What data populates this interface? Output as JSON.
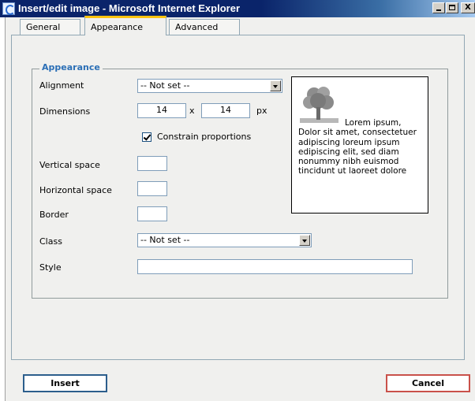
{
  "window": {
    "title": "Insert/edit image - Microsoft Internet Explorer",
    "controls": {
      "minimize": "_",
      "maximize": "□",
      "close": "X"
    }
  },
  "tabs": [
    {
      "label": "General",
      "active": false
    },
    {
      "label": "Appearance",
      "active": true
    },
    {
      "label": "Advanced",
      "active": false
    }
  ],
  "appearance": {
    "legend": "Appearance",
    "alignment": {
      "label": "Alignment",
      "value": "-- Not set --"
    },
    "dimensions": {
      "label": "Dimensions",
      "width": "14",
      "height": "14",
      "times": "x",
      "unit": "px"
    },
    "constrain": {
      "label": "Constrain proportions",
      "checked": true
    },
    "vertical_space": {
      "label": "Vertical space",
      "value": ""
    },
    "horizontal_space": {
      "label": "Horizontal space",
      "value": ""
    },
    "border": {
      "label": "Border",
      "value": ""
    },
    "class": {
      "label": "Class",
      "value": "-- Not set --"
    },
    "style": {
      "label": "Style",
      "value": ""
    },
    "preview": {
      "first_line": "Lorem ipsum,",
      "rest": "Dolor sit amet, consectetuer adipiscing loreum ipsum edipiscing elit, sed diam nonummy nibh euismod tincidunt ut laoreet dolore"
    }
  },
  "buttons": {
    "insert": "Insert",
    "cancel": "Cancel"
  },
  "colors": {
    "title_bar": "#0a246a",
    "active_tab_accent": "#ffc30e",
    "legend_text": "#2b6fb6",
    "insert_border": "#2c5e8c",
    "cancel_border": "#c9514a"
  }
}
